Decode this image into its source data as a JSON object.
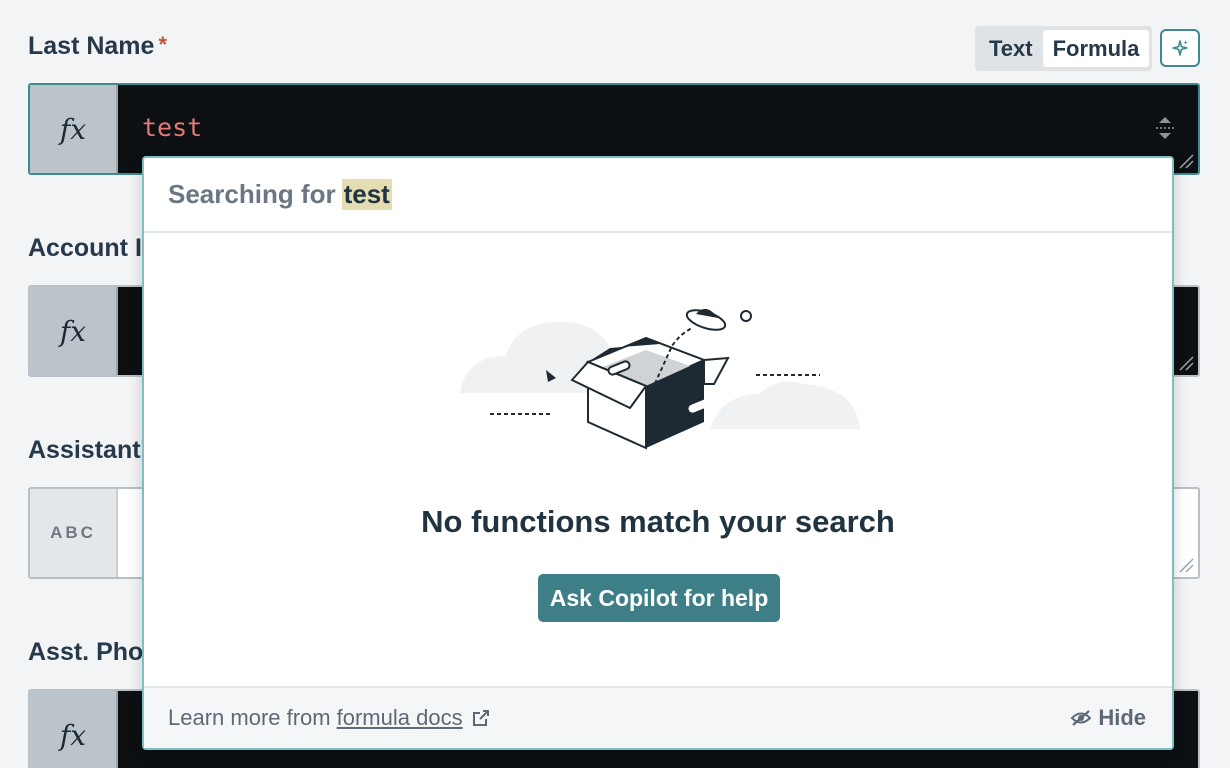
{
  "fields": [
    {
      "label": "Last Name",
      "required_mark": "*",
      "prefix": "fx",
      "value": "test"
    },
    {
      "label": "Account Il",
      "prefix": "fx",
      "value": ""
    },
    {
      "label": "Assistant'",
      "prefix": "ABC",
      "value": ""
    },
    {
      "label": "Asst. Phor",
      "prefix": "fx",
      "value": ""
    }
  ],
  "mode_toggle": {
    "options": [
      "Text",
      "Formula"
    ],
    "selected": "Formula"
  },
  "copilot_button_icon": "sparkle-icon",
  "popup": {
    "searching_prefix": "Searching for",
    "search_term": "test",
    "empty_title": "No functions match your search",
    "ask_button": "Ask Copilot for help",
    "footer_text": "Learn more from",
    "footer_link": "formula docs",
    "hide_label": "Hide"
  },
  "colors": {
    "accent": "#3e7f87",
    "code_bg": "#0c1012",
    "code_text": "#e27a76",
    "highlight": "#e5ddb2",
    "required": "#c0553b"
  }
}
